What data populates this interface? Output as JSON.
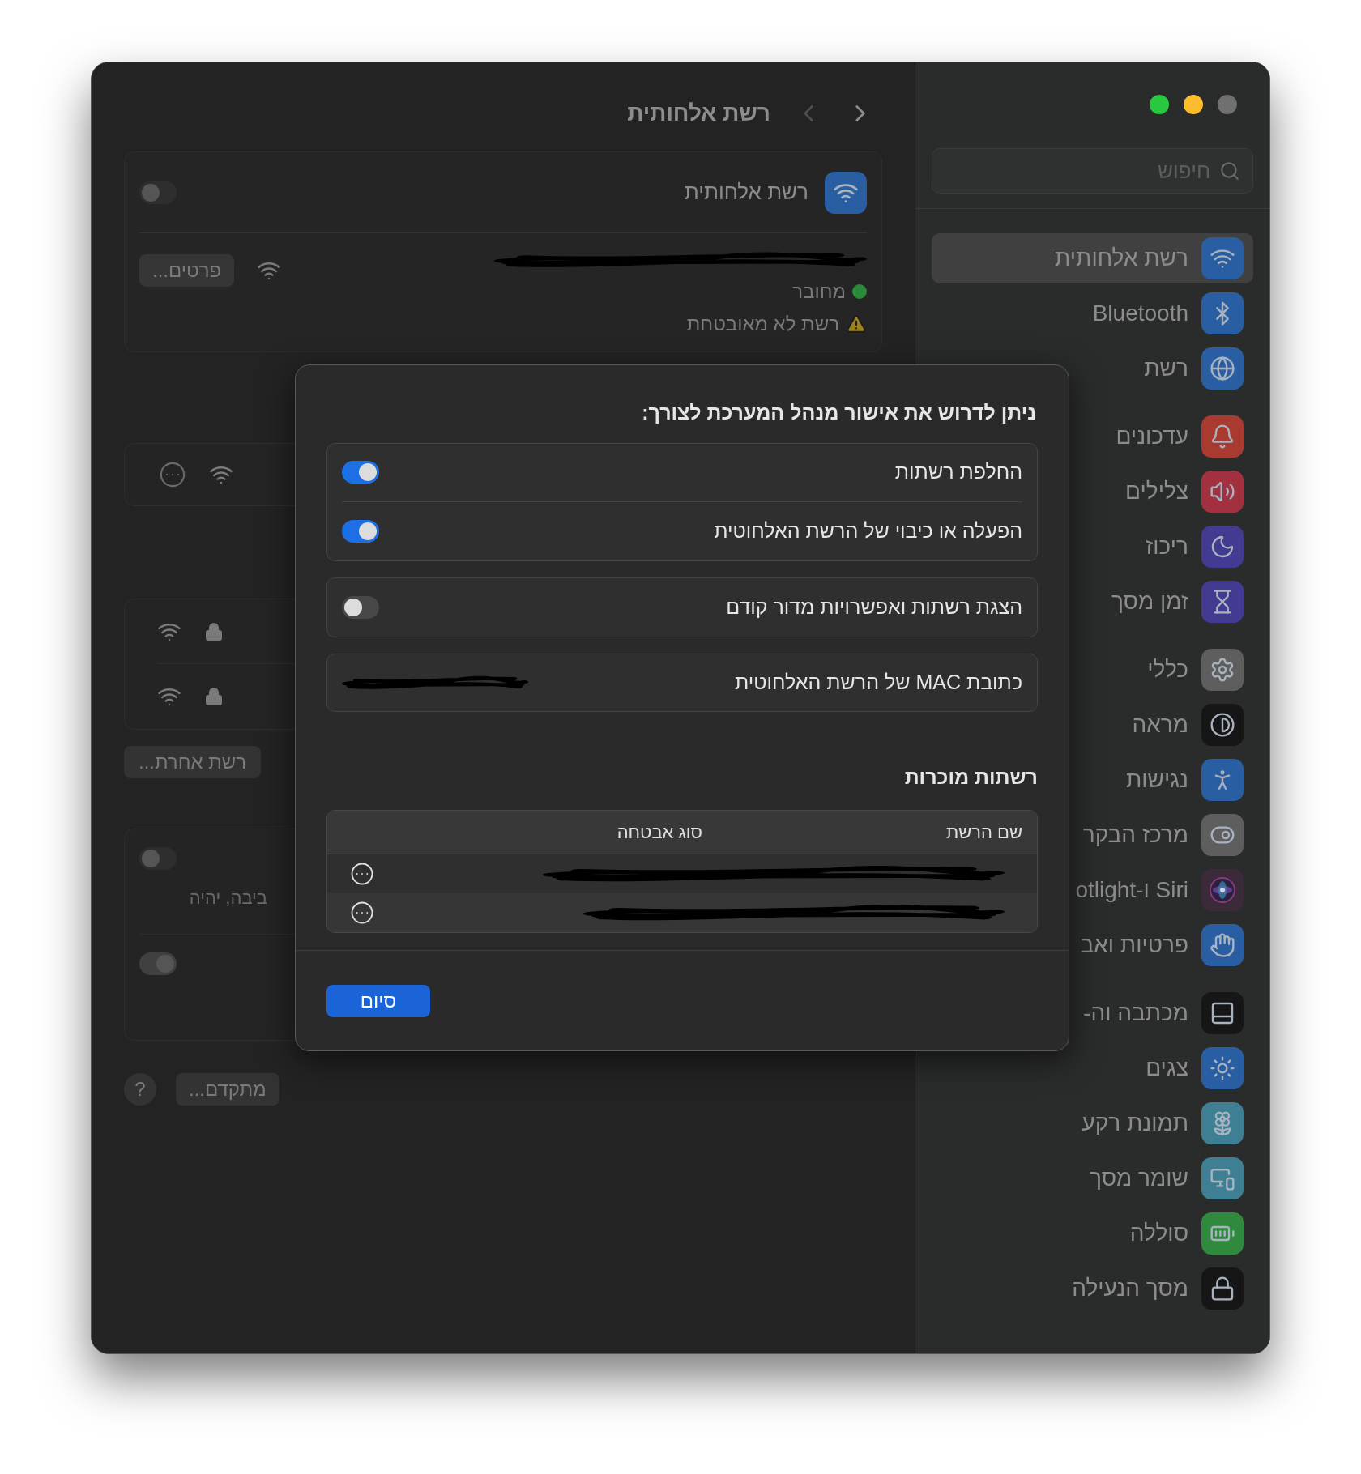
{
  "main": {
    "title": "רשת אלחותית",
    "wifi_card": {
      "label": "רשת אלחותית",
      "on": false,
      "status": "מחובר",
      "warning": "רשת לא מאובטחת",
      "details_button": "פרטים..."
    },
    "other_network_button": "רשת אחרת...",
    "settings_card": {
      "fragment": "ביבה, יהיה",
      "toggles": [
        {
          "on": false
        },
        {
          "on": true
        }
      ]
    },
    "advanced_button": "מתקדם...",
    "help_button": "?"
  },
  "sidebar": {
    "search": {
      "placeholder": "חיפוש"
    },
    "groups": [
      [
        {
          "label": "רשת אלחותית",
          "selected": true,
          "color": "#2a5ea3"
        },
        {
          "label": "Bluetooth",
          "selected": false,
          "color": "#2a5ea3"
        },
        {
          "label": "רשת",
          "selected": false,
          "color": "#2a5ea3"
        }
      ],
      [
        {
          "label": "עדכונים",
          "selected": false,
          "color": "#a83a30"
        },
        {
          "label": "צלילים",
          "selected": false,
          "color": "#a3303f"
        },
        {
          "label": "ריכוז",
          "selected": false,
          "color": "#433a92"
        },
        {
          "label": "זמן מסך",
          "selected": false,
          "color": "#433a92"
        }
      ],
      [
        {
          "label": "כללי",
          "selected": false,
          "color": "#5e5e5e"
        },
        {
          "label": "מראה",
          "selected": false,
          "color": "#161616"
        },
        {
          "label": "נגישות",
          "selected": false,
          "color": "#2a5ea3"
        },
        {
          "label": "מרכז הבקר",
          "selected": false,
          "color": "#5e5e5e"
        },
        {
          "label": "Siri ו-otlight",
          "selected": false,
          "color": "#3a2a3a"
        },
        {
          "label": "פרטיות ואב",
          "selected": false,
          "color": "#2a5ea3"
        }
      ],
      [
        {
          "label": "מכתבה וה-",
          "selected": false,
          "color": "#161616"
        },
        {
          "label": "צגים",
          "selected": false,
          "color": "#2a5ea3"
        },
        {
          "label": "תמונת רקע",
          "selected": false,
          "color": "#3e7f93"
        },
        {
          "label": "שומר מסך",
          "selected": false,
          "color": "#3e7f93"
        },
        {
          "label": "סוללה",
          "selected": false,
          "color": "#2f8a3e"
        },
        {
          "label": "מסך הנעילה",
          "selected": false,
          "color": "#161616"
        }
      ]
    ]
  },
  "dialog": {
    "heading": "ניתן לדרוש את אישור מנהל המערכת לצורך:",
    "groups": [
      [
        {
          "label": "החלפת רשתות",
          "on": true
        },
        {
          "label": "הפעלה או כיבוי של הרשת האלחוטית",
          "on": true
        }
      ],
      [
        {
          "label": "הצגת רשתות ואפשרויות מדור קודם",
          "on": false
        }
      ]
    ],
    "mac_label": "כתובת MAC של הרשת האלחוטית",
    "known_title": "רשתות מוכרות",
    "columns": [
      "שם הרשת",
      "סוג אבטחה"
    ],
    "rows": [
      {
        "kind": "redacted"
      },
      {
        "kind": "redacted"
      }
    ],
    "done_button": "סיום"
  }
}
